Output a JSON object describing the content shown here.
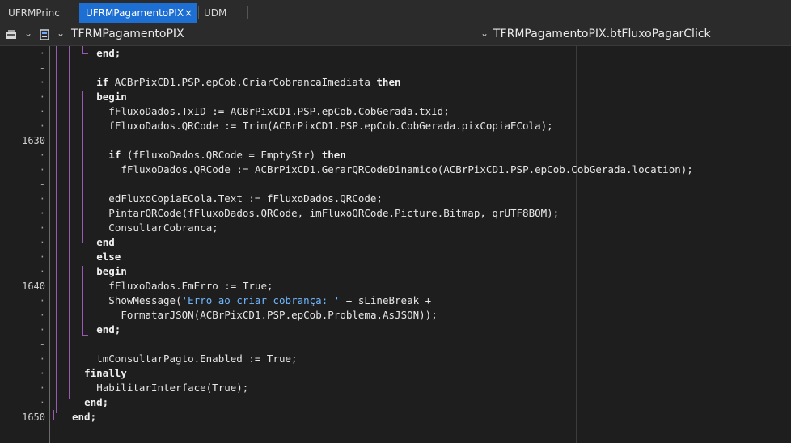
{
  "tabs": [
    {
      "label": "UFRMPrinc",
      "active": false
    },
    {
      "label": "UFRMPagamentoPIX",
      "active": true,
      "close": "×"
    },
    {
      "label": "UDM",
      "active": false
    }
  ],
  "navigator": {
    "class_name": "TFRMPagamentoPIX",
    "method_name": "TFRMPagamentoPIX.btFluxoPagarClick",
    "chevron": "⌄"
  },
  "gutter": [
    "·",
    "-",
    "·",
    "·",
    "·",
    "·",
    "1630",
    "·",
    "·",
    "-",
    "·",
    "·",
    "·",
    "·",
    "·",
    "·",
    "1640",
    "·",
    "·",
    "·",
    "-",
    "·",
    "·",
    "·",
    "·",
    "1650"
  ],
  "code_lines": [
    {
      "indent": 13,
      "parts": [
        {
          "t": "end;",
          "k": "kw"
        }
      ]
    },
    {
      "indent": 0,
      "parts": []
    },
    {
      "indent": 13,
      "parts": [
        {
          "t": "if",
          "k": "kw"
        },
        {
          "t": " ACBrPixCD1.PSP.epCob.CriarCobrancaImediata ",
          "k": ""
        },
        {
          "t": "then",
          "k": "kw"
        }
      ]
    },
    {
      "indent": 13,
      "parts": [
        {
          "t": "begin",
          "k": "kw"
        }
      ]
    },
    {
      "indent": 15,
      "parts": [
        {
          "t": "fFluxoDados.TxID := ACBrPixCD1.PSP.epCob.CobGerada.txId;",
          "k": ""
        }
      ]
    },
    {
      "indent": 15,
      "parts": [
        {
          "t": "fFluxoDados.QRCode := Trim(ACBrPixCD1.PSP.epCob.CobGerada.pixCopiaECola);",
          "k": ""
        }
      ]
    },
    {
      "indent": 0,
      "parts": []
    },
    {
      "indent": 15,
      "parts": [
        {
          "t": "if",
          "k": "kw"
        },
        {
          "t": " (fFluxoDados.QRCode = EmptyStr) ",
          "k": ""
        },
        {
          "t": "then",
          "k": "kw"
        }
      ]
    },
    {
      "indent": 17,
      "parts": [
        {
          "t": "fFluxoDados.QRCode := ACBrPixCD1.GerarQRCodeDinamico(ACBrPixCD1.PSP.epCob.CobGerada.location);",
          "k": ""
        }
      ]
    },
    {
      "indent": 0,
      "parts": []
    },
    {
      "indent": 15,
      "parts": [
        {
          "t": "edFluxoCopiaECola.Text := fFluxoDados.QRCode;",
          "k": ""
        }
      ]
    },
    {
      "indent": 15,
      "parts": [
        {
          "t": "PintarQRCode(fFluxoDados.QRCode, imFluxoQRCode.Picture.Bitmap, qrUTF8BOM);",
          "k": ""
        }
      ]
    },
    {
      "indent": 15,
      "parts": [
        {
          "t": "ConsultarCobranca;",
          "k": ""
        }
      ]
    },
    {
      "indent": 13,
      "parts": [
        {
          "t": "end",
          "k": "kw"
        }
      ]
    },
    {
      "indent": 13,
      "parts": [
        {
          "t": "else",
          "k": "kw"
        }
      ]
    },
    {
      "indent": 13,
      "parts": [
        {
          "t": "begin",
          "k": "kw"
        }
      ]
    },
    {
      "indent": 15,
      "parts": [
        {
          "t": "fFluxoDados.EmErro := True;",
          "k": ""
        }
      ]
    },
    {
      "indent": 15,
      "parts": [
        {
          "t": "ShowMessage(",
          "k": ""
        },
        {
          "t": "'Erro ao criar cobrança: '",
          "k": "str"
        },
        {
          "t": " + sLineBreak +",
          "k": ""
        }
      ]
    },
    {
      "indent": 17,
      "parts": [
        {
          "t": "FormatarJSON(ACBrPixCD1.PSP.epCob.Problema.AsJSON));",
          "k": ""
        }
      ]
    },
    {
      "indent": 13,
      "parts": [
        {
          "t": "end;",
          "k": "kw"
        }
      ]
    },
    {
      "indent": 0,
      "parts": []
    },
    {
      "indent": 13,
      "parts": [
        {
          "t": "tmConsultarPagto.Enabled := True;",
          "k": ""
        }
      ]
    },
    {
      "indent": 11,
      "parts": [
        {
          "t": "finally",
          "k": "kw"
        }
      ]
    },
    {
      "indent": 13,
      "parts": [
        {
          "t": "HabilitarInterface(True);",
          "k": ""
        }
      ]
    },
    {
      "indent": 11,
      "parts": [
        {
          "t": "end;",
          "k": "kw"
        }
      ]
    },
    {
      "indent": 9,
      "parts": [
        {
          "t": "end;",
          "k": "kw"
        }
      ]
    }
  ],
  "colors": {
    "keyword": "#f0f0f0",
    "string": "#6fb7ff",
    "structure": "#9b59b6",
    "tab_active": "#1e6fd3"
  }
}
